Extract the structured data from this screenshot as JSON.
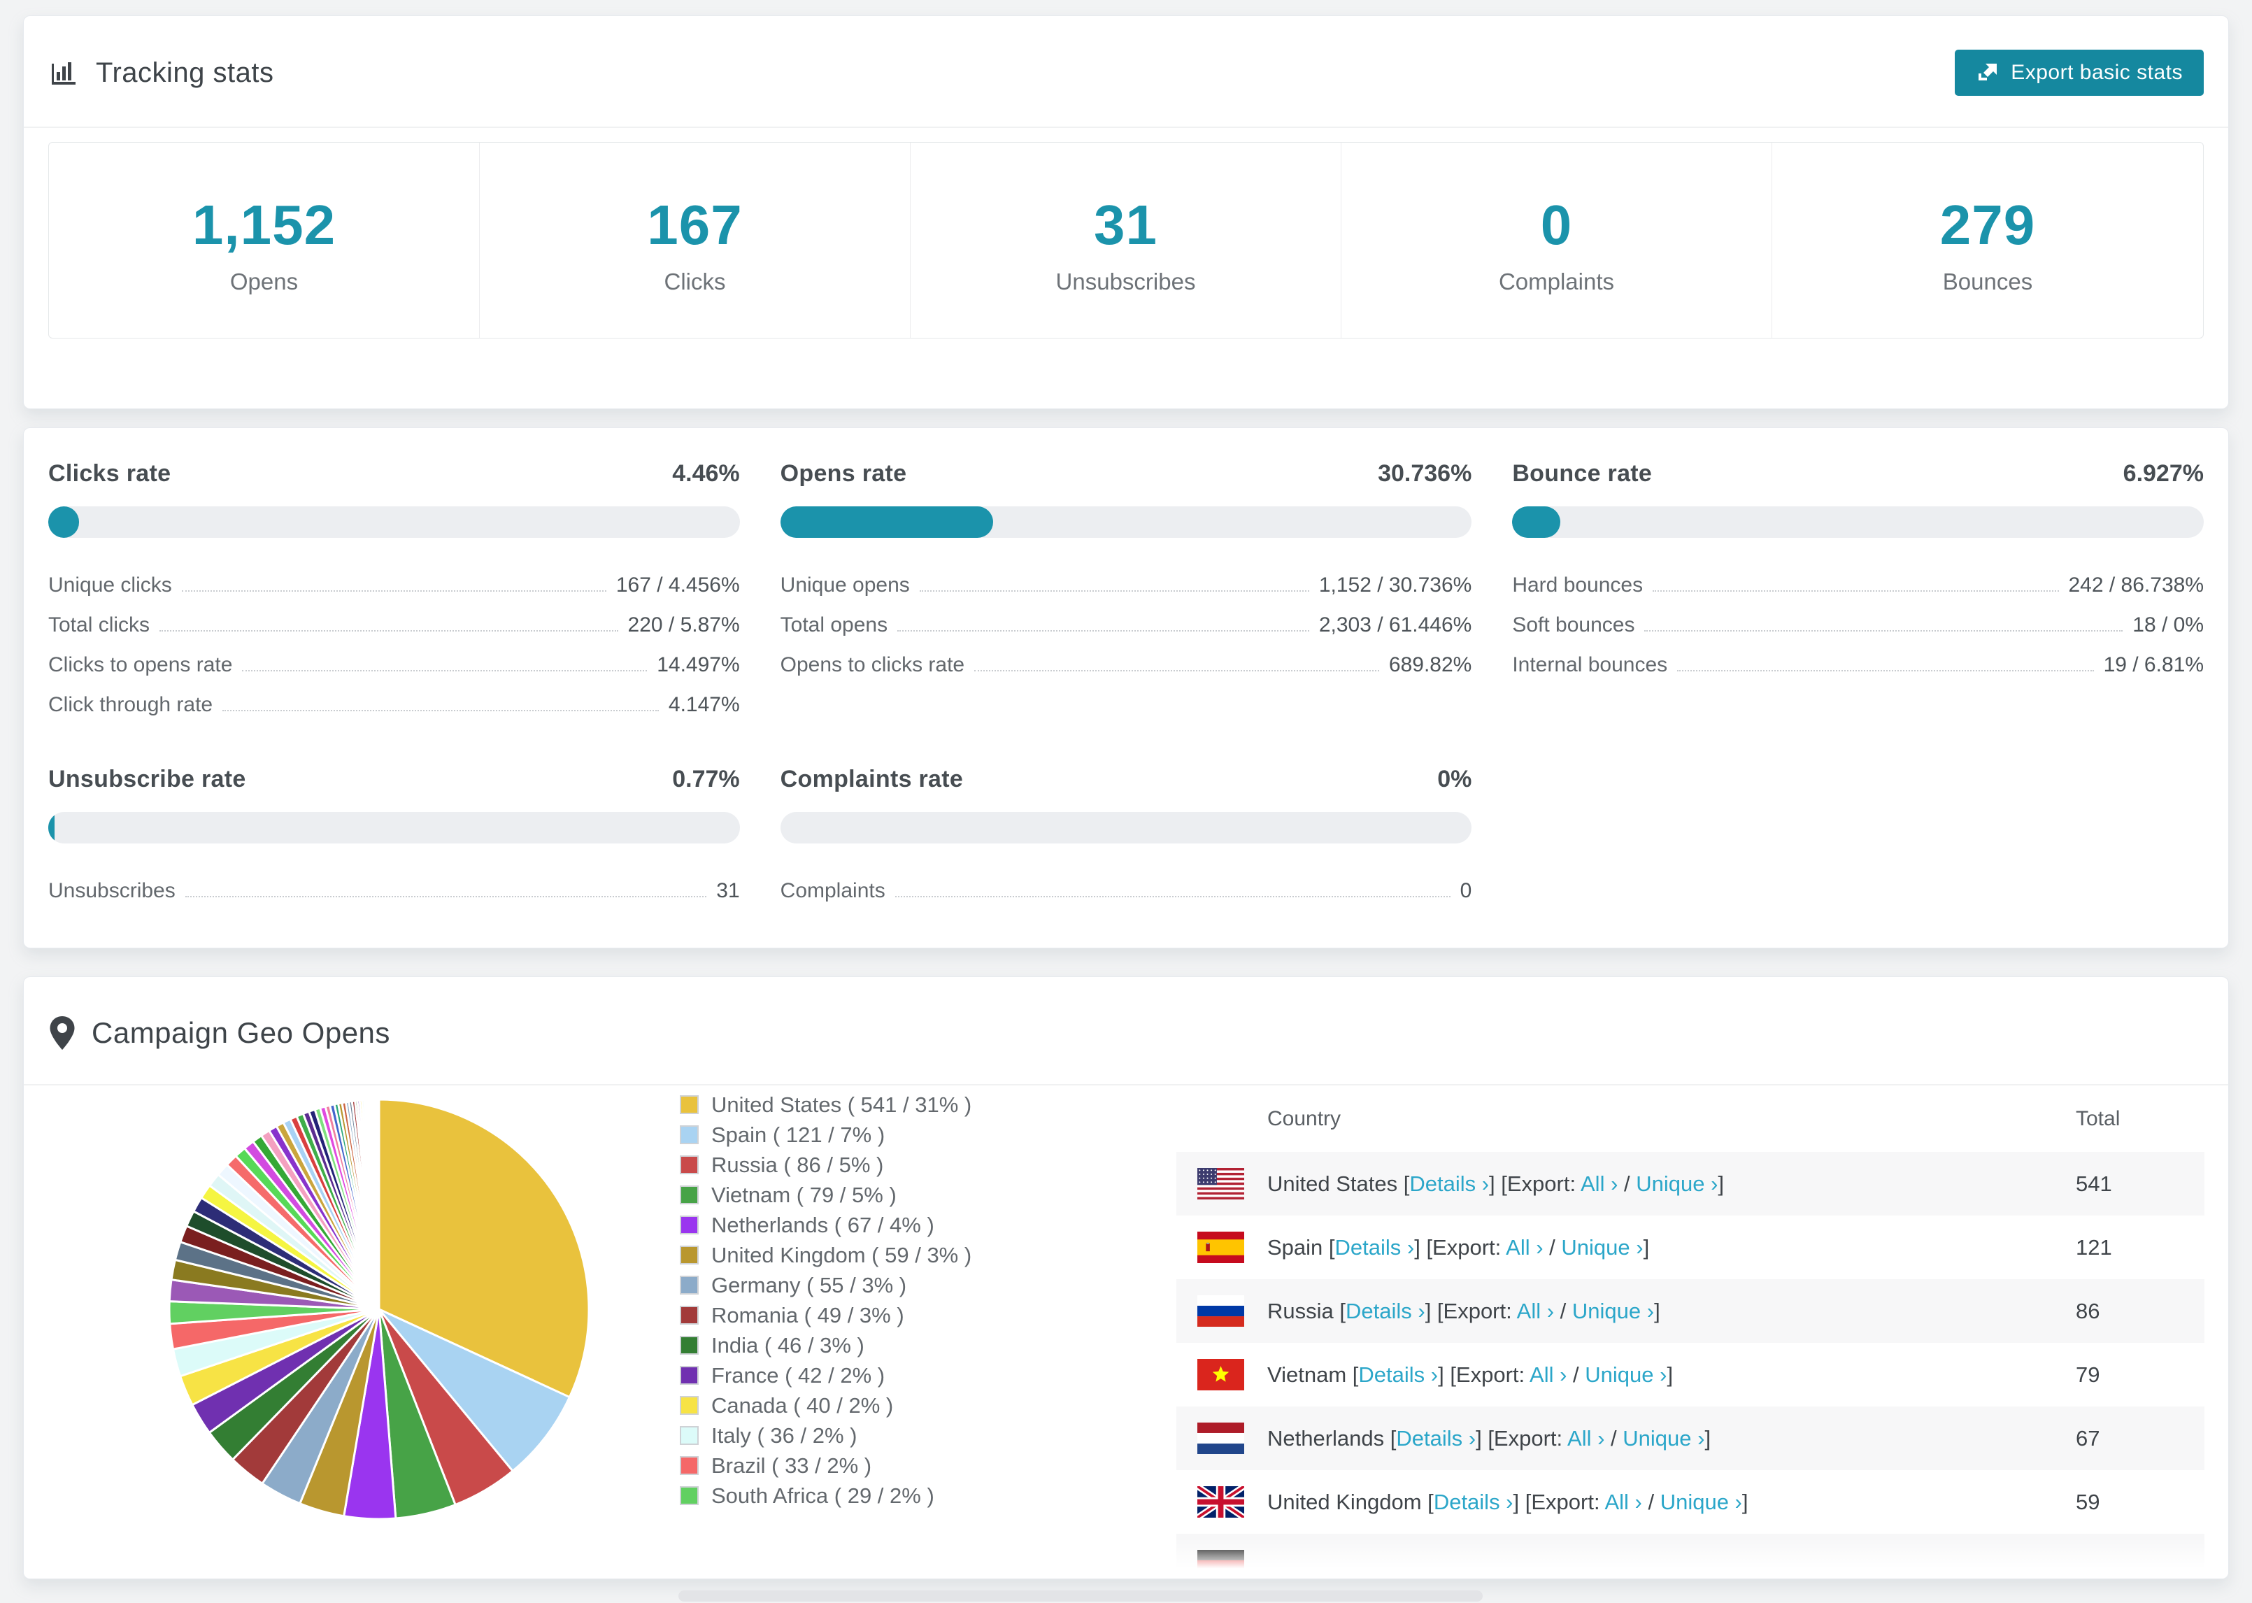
{
  "colors": {
    "accent": "#1b93ab",
    "button": "#15889f",
    "link": "#2ba6c9"
  },
  "tracking": {
    "title": "Tracking stats",
    "export_label": "Export basic stats"
  },
  "summary": [
    {
      "value": "1,152",
      "label": "Opens"
    },
    {
      "value": "167",
      "label": "Clicks"
    },
    {
      "value": "31",
      "label": "Unsubscribes"
    },
    {
      "value": "0",
      "label": "Complaints"
    },
    {
      "value": "279",
      "label": "Bounces"
    }
  ],
  "rate_blocks": [
    {
      "id": "clicks",
      "title": "Clicks rate",
      "value": "4.46%",
      "percent": 4.46,
      "rows": [
        {
          "label": "Unique clicks",
          "value": "167 / 4.456%"
        },
        {
          "label": "Total clicks",
          "value": "220 / 5.87%"
        },
        {
          "label": "Clicks to opens rate",
          "value": "14.497%"
        },
        {
          "label": "Click through rate",
          "value": "4.147%"
        }
      ]
    },
    {
      "id": "opens",
      "title": "Opens rate",
      "value": "30.736%",
      "percent": 30.736,
      "rows": [
        {
          "label": "Unique opens",
          "value": "1,152 / 30.736%"
        },
        {
          "label": "Total opens",
          "value": "2,303 / 61.446%"
        },
        {
          "label": "Opens to clicks rate",
          "value": "689.82%"
        }
      ]
    },
    {
      "id": "bounce",
      "title": "Bounce rate",
      "value": "6.927%",
      "percent": 6.927,
      "rows": [
        {
          "label": "Hard bounces",
          "value": "242 / 86.738%"
        },
        {
          "label": "Soft bounces",
          "value": "18 / 0%"
        },
        {
          "label": "Internal bounces",
          "value": "19 / 6.81%"
        }
      ]
    },
    {
      "id": "unsubscribe",
      "title": "Unsubscribe rate",
      "value": "0.77%",
      "percent": 0.77,
      "rows": [
        {
          "label": "Unsubscribes",
          "value": "31"
        }
      ]
    },
    {
      "id": "complaints",
      "title": "Complaints rate",
      "value": "0%",
      "percent": 0,
      "rows": [
        {
          "label": "Complaints",
          "value": "0"
        }
      ]
    }
  ],
  "geo": {
    "title": "Campaign Geo Opens",
    "legend": [
      {
        "label": "United States ( 541 / 31% )",
        "color": "#e9c23d"
      },
      {
        "label": "Spain ( 121 / 7% )",
        "color": "#a9d3f2"
      },
      {
        "label": "Russia ( 86 / 5% )",
        "color": "#c94a4a"
      },
      {
        "label": "Vietnam ( 79 / 5% )",
        "color": "#47a347"
      },
      {
        "label": "Netherlands ( 67 / 4% )",
        "color": "#9a35ef"
      },
      {
        "label": "United Kingdom ( 59 / 3% )",
        "color": "#b9972f"
      },
      {
        "label": "Germany ( 55 / 3% )",
        "color": "#8cabc9"
      },
      {
        "label": "Romania ( 49 / 3% )",
        "color": "#a23a3a"
      },
      {
        "label": "India ( 46 / 3% )",
        "color": "#337e33"
      },
      {
        "label": "France ( 42 / 2% )",
        "color": "#7030b0"
      },
      {
        "label": "Canada ( 40 / 2% )",
        "color": "#f7e345"
      },
      {
        "label": "Italy ( 36 / 2% )",
        "color": "#dcfbf9"
      },
      {
        "label": "Brazil ( 33 / 2% )",
        "color": "#f56868"
      },
      {
        "label": "South Africa ( 29 / 2% )",
        "color": "#61d061"
      }
    ],
    "table": {
      "columns": [
        "Country",
        "Total"
      ],
      "tokens": {
        "b1": "[",
        "b2": "]",
        "sep": "/",
        "export_label": "Export:",
        "details": "Details ›",
        "all": "All ›",
        "unique": "Unique ›"
      },
      "rows": [
        {
          "flag": "us",
          "country": "United States",
          "total": "541"
        },
        {
          "flag": "es",
          "country": "Spain",
          "total": "121"
        },
        {
          "flag": "ru",
          "country": "Russia",
          "total": "86"
        },
        {
          "flag": "vn",
          "country": "Vietnam",
          "total": "79"
        },
        {
          "flag": "nl",
          "country": "Netherlands",
          "total": "67"
        },
        {
          "flag": "gb",
          "country": "United Kingdom",
          "total": "59"
        },
        {
          "flag": "de",
          "country": "",
          "total": "",
          "partial": true
        }
      ]
    },
    "chart_data": {
      "type": "pie",
      "title": "Campaign Geo Opens",
      "legend_position": "right",
      "slices": [
        {
          "label": "United States",
          "value": 541,
          "pct": "31%",
          "color": "#e9c23d"
        },
        {
          "label": "Spain",
          "value": 121,
          "pct": "7%",
          "color": "#a9d3f2"
        },
        {
          "label": "Russia",
          "value": 86,
          "pct": "5%",
          "color": "#c94a4a"
        },
        {
          "label": "Vietnam",
          "value": 79,
          "pct": "5%",
          "color": "#47a347"
        },
        {
          "label": "Netherlands",
          "value": 67,
          "pct": "4%",
          "color": "#9a35ef"
        },
        {
          "label": "United Kingdom",
          "value": 59,
          "pct": "3%",
          "color": "#b9972f"
        },
        {
          "label": "Germany",
          "value": 55,
          "pct": "3%",
          "color": "#8cabc9"
        },
        {
          "label": "Romania",
          "value": 49,
          "pct": "3%",
          "color": "#a23a3a"
        },
        {
          "label": "India",
          "value": 46,
          "pct": "3%",
          "color": "#337e33"
        },
        {
          "label": "France",
          "value": 42,
          "pct": "2%",
          "color": "#7030b0"
        },
        {
          "label": "Canada",
          "value": 40,
          "pct": "2%",
          "color": "#f7e345"
        },
        {
          "label": "Italy",
          "value": 36,
          "pct": "2%",
          "color": "#dcfbf9"
        },
        {
          "label": "Brazil",
          "value": 33,
          "pct": "2%",
          "color": "#f56868"
        },
        {
          "label": "South Africa",
          "value": 29,
          "pct": "2%",
          "color": "#61d061"
        }
      ],
      "unlabeled_small_slices": {
        "values": [
          28,
          26,
          24,
          22,
          21,
          20,
          19,
          18,
          17,
          16,
          15,
          14,
          13,
          12,
          11,
          10,
          10,
          9,
          9,
          8,
          8,
          7,
          7,
          6,
          6,
          5,
          5,
          5,
          4,
          4,
          4,
          3,
          3,
          3,
          3,
          2,
          2,
          2,
          2,
          2,
          2,
          1,
          1,
          1,
          1,
          1,
          1,
          1
        ],
        "colors": [
          "#9b59b6",
          "#8a7a20",
          "#5c7287",
          "#7a1f1f",
          "#1e4d2b",
          "#2d2d77",
          "#f5f542",
          "#dff6f6",
          "#eef7ff",
          "#f56b6b",
          "#57d957",
          "#d24be0",
          "#35a835",
          "#f4a0c0",
          "#8833cc",
          "#caa53d",
          "#a8d2f4",
          "#d94040",
          "#3fae49",
          "#5b2d90",
          "#232377",
          "#7ee07e",
          "#e04be0",
          "#f080a0",
          "#4466cc",
          "#2aa87a",
          "#b8962e",
          "#cc6644",
          "#88aac8",
          "#6d8296",
          "#a33b3b",
          "#317a31",
          "#7229b8",
          "#f9e64a",
          "#d9fbfb",
          "#f56565",
          "#62d161",
          "#e9c23d",
          "#9333ea",
          "#c94747",
          "#46a046",
          "#8a2be2",
          "#ff7799",
          "#66ccee",
          "#1a8fa6",
          "#d2691e",
          "#808000",
          "#483d8b"
        ]
      }
    }
  }
}
